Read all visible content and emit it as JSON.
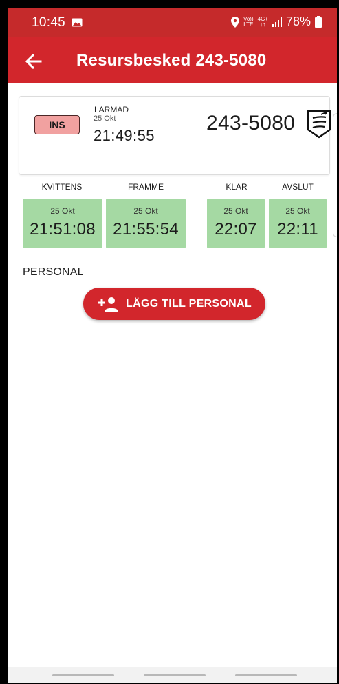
{
  "status_bar": {
    "time": "10:45",
    "network_top1": "Vo))",
    "network_bottom1": "LTE",
    "network_top2": "4G+",
    "network_bottom2": "↓↑",
    "battery": "78%",
    "icons": [
      "gallery-icon",
      "location-icon",
      "signal-icon",
      "battery-icon"
    ]
  },
  "app_bar": {
    "title": "Resursbesked 243-5080",
    "back_icon": "arrow-back-icon",
    "color": "#d2262c"
  },
  "resource_card": {
    "status_badge": "INS",
    "alarm_label": "LARMAD",
    "alarm_date": "25 Okt",
    "alarm_time": "21:49:55",
    "unit_number": "243-5080",
    "unit_icon": "vehicle-badge-icon"
  },
  "timeline": [
    {
      "header": "KVITTENS",
      "date": "25 Okt",
      "time": "21:51:08"
    },
    {
      "header": "FRAMME",
      "date": "25 Okt",
      "time": "21:55:54"
    },
    {
      "header": "KLAR",
      "date": "25 Okt",
      "time": "22:07"
    },
    {
      "header": "AVSLUT",
      "date": "25 Okt",
      "time": "22:11"
    }
  ],
  "personal": {
    "section_label": "PERSONAL",
    "add_button_label": "LÄGG TILL PERSONAL",
    "add_icon": "person-add-icon"
  },
  "colors": {
    "primary": "#d2262c",
    "status_bar": "#c52a2b",
    "badge": "#f1a1a0",
    "time_box": "#a5d9a3"
  }
}
